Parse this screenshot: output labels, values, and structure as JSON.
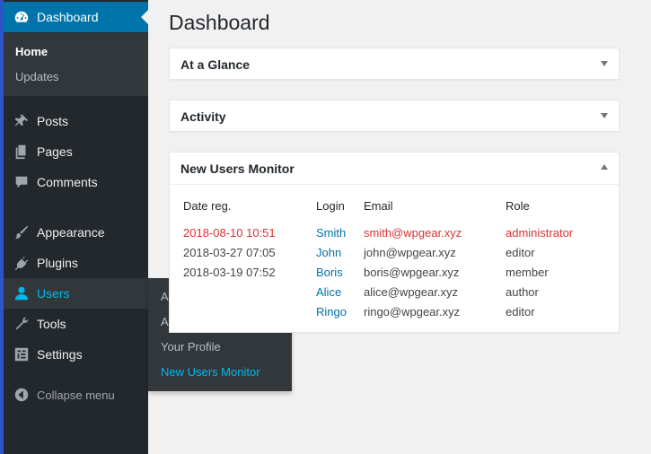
{
  "sidebar": {
    "top": {
      "label": "Dashboard",
      "icon": "dashboard-icon"
    },
    "dashboard_sub": {
      "home": "Home",
      "updates": "Updates"
    },
    "items": [
      {
        "label": "Posts",
        "icon": "pushpin-icon"
      },
      {
        "label": "Pages",
        "icon": "pages-icon"
      },
      {
        "label": "Comments",
        "icon": "comment-icon"
      },
      {
        "label": "Appearance",
        "icon": "brush-icon"
      },
      {
        "label": "Plugins",
        "icon": "plugin-icon"
      },
      {
        "label": "Users",
        "icon": "user-icon"
      },
      {
        "label": "Tools",
        "icon": "wrench-icon"
      },
      {
        "label": "Settings",
        "icon": "settings-icon"
      }
    ],
    "collapse": "Collapse menu"
  },
  "flyout": {
    "items": [
      "All Users",
      "Add New",
      "Your Profile",
      "New Users Monitor"
    ]
  },
  "main": {
    "title": "Dashboard",
    "boxes": {
      "glance": "At a Glance",
      "activity": "Activity",
      "monitor": "New Users Monitor"
    },
    "table": {
      "headers": [
        "Date reg.",
        "Login",
        "Email",
        "Role"
      ],
      "rows": [
        {
          "date": "2018-08-10 10:51",
          "login": "Smith",
          "email": "smith@wpgear.xyz",
          "role": "administrator"
        },
        {
          "date": "2018-03-27 07:05",
          "login": "John",
          "email": "john@wpgear.xyz",
          "role": "editor"
        },
        {
          "date": "2018-03-19 07:52",
          "login": "Boris",
          "email": "boris@wpgear.xyz",
          "role": "member"
        },
        {
          "date": "",
          "login": "Alice",
          "email": "alice@wpgear.xyz",
          "role": "author"
        },
        {
          "date": "",
          "login": "Ringo",
          "email": "ringo@wpgear.xyz",
          "role": "editor"
        }
      ]
    }
  },
  "colors": {
    "accent": "#0073aa",
    "highlight": "#00b9eb",
    "admin_red": "#dc3232",
    "sidebar_bg": "#23282d"
  }
}
